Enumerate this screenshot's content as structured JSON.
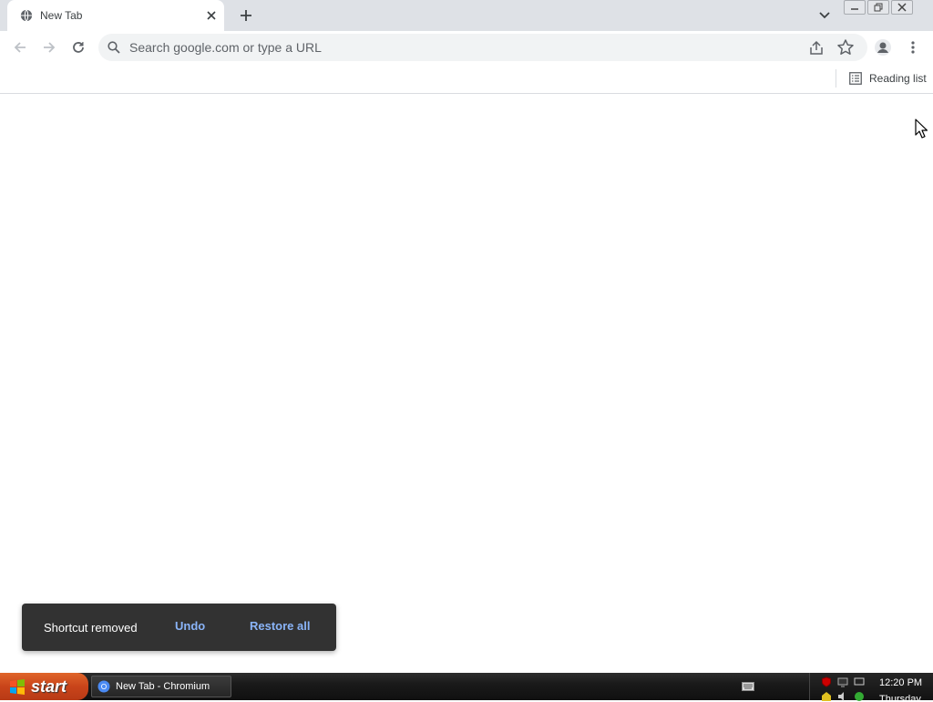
{
  "tab": {
    "title": "New Tab"
  },
  "omnibox": {
    "placeholder": "Search google.com or type a URL"
  },
  "bookmarks": {
    "reading_list_label": "Reading list"
  },
  "toast": {
    "message": "Shortcut removed",
    "undo_label": "Undo",
    "restore_label": "Restore all"
  },
  "taskbar": {
    "start_label": "start",
    "window_label": "New Tab - Chromium"
  },
  "tray": {
    "time": "12:20 PM",
    "day": "Thursday"
  },
  "colors": {
    "tabstrip": "#dee1e6",
    "toast_bg": "#323232",
    "toast_action": "#8ab4f8",
    "start": "#c9441a"
  }
}
